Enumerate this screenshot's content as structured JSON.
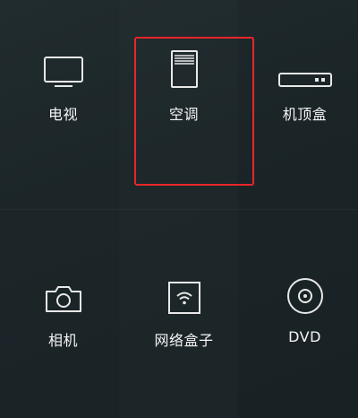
{
  "devices": [
    {
      "id": "tv",
      "label": "电视",
      "icon": "tv-icon"
    },
    {
      "id": "ac",
      "label": "空调",
      "icon": "air-conditioner-icon"
    },
    {
      "id": "stb",
      "label": "机顶盒",
      "icon": "set-top-box-icon"
    },
    {
      "id": "camera",
      "label": "相机",
      "icon": "camera-icon"
    },
    {
      "id": "netbox",
      "label": "网络盒子",
      "icon": "wifi-box-icon"
    },
    {
      "id": "dvd",
      "label": "DVD",
      "icon": "disc-icon"
    }
  ],
  "selected_device": "ac",
  "colors": {
    "background": "#1c2629",
    "icon_stroke": "#e8e8e8",
    "label_text": "#f4f4f4",
    "highlight_border": "#e8262b"
  }
}
